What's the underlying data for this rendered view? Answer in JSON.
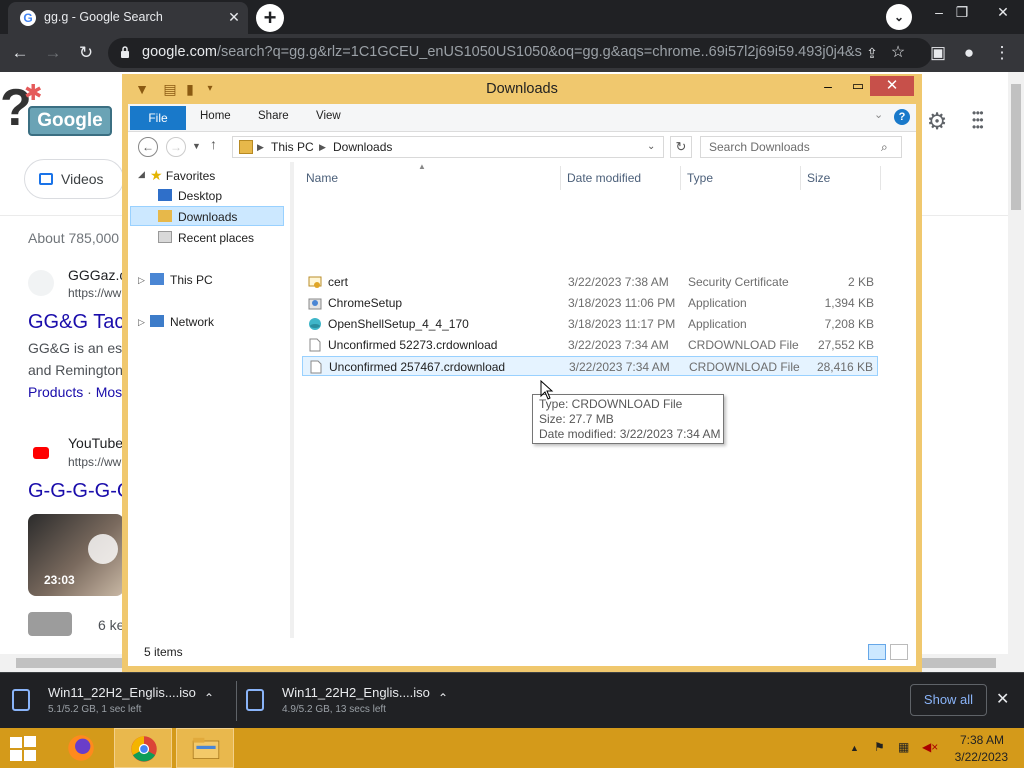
{
  "browser": {
    "tab_title": "gg.g - Google Search",
    "tab_favicon": "G",
    "url_host": "google.com",
    "url_rest": "/search?q=gg.g&rlz=1C1GCEU_enUS1050US1050&oq=gg.g&aqs=chrome..69i57l2j69i59.493j0j4&so..."
  },
  "google": {
    "logo_text": "Google",
    "videos_label": "Videos",
    "result_stats": "About 785,000",
    "results": [
      {
        "site": "GGGaz.c",
        "cite": "https://ww",
        "title": "GG&G Tact",
        "snippet1": "GG&G is an est",
        "snippet2": "and Remington",
        "link1": "Products",
        "sep": " · ",
        "link2": "Mos"
      },
      {
        "site": "YouTube",
        "cite": "https://ww",
        "title": "G-G-G-G-G"
      }
    ],
    "video_duration": "23:03",
    "key_moments": "6 ke"
  },
  "explorer": {
    "title": "Downloads",
    "ribbon_tabs": [
      "File",
      "Home",
      "Share",
      "View"
    ],
    "breadcrumb": [
      "This PC",
      "Downloads"
    ],
    "search_placeholder": "Search Downloads",
    "nav": {
      "favorites": "Favorites",
      "desktop": "Desktop",
      "downloads": "Downloads",
      "recent": "Recent places",
      "this_pc": "This PC",
      "network": "Network"
    },
    "columns": [
      "Name",
      "Date modified",
      "Type",
      "Size"
    ],
    "files": [
      {
        "name": "cert",
        "date": "3/22/2023 7:38 AM",
        "type": "Security Certificate",
        "size": "2 KB",
        "icon": "certificate-icon"
      },
      {
        "name": "ChromeSetup",
        "date": "3/18/2023 11:06 PM",
        "type": "Application",
        "size": "1,394 KB",
        "icon": "installer-icon"
      },
      {
        "name": "OpenShellSetup_4_4_170",
        "date": "3/18/2023 11:17 PM",
        "type": "Application",
        "size": "7,208 KB",
        "icon": "shell-icon"
      },
      {
        "name": "Unconfirmed 52273.crdownload",
        "date": "3/22/2023 7:34 AM",
        "type": "CRDOWNLOAD File",
        "size": "27,552 KB",
        "icon": "file-icon"
      },
      {
        "name": "Unconfirmed 257467.crdownload",
        "date": "3/22/2023 7:34 AM",
        "type": "CRDOWNLOAD File",
        "size": "28,416 KB",
        "icon": "file-icon"
      }
    ],
    "tooltip": {
      "type": "Type: CRDOWNLOAD File",
      "size": "Size: 27.7 MB",
      "date": "Date modified: 3/22/2023 7:34 AM"
    },
    "status": "5 items"
  },
  "downloads_bar": {
    "items": [
      {
        "name": "Win11_22H2_Englis....iso",
        "status": "5.1/5.2 GB, 1 sec left"
      },
      {
        "name": "Win11_22H2_Englis....iso",
        "status": "4.9/5.2 GB, 13 secs left"
      }
    ],
    "show_all": "Show all"
  },
  "taskbar": {
    "time": "7:38 AM",
    "date": "3/22/2023"
  }
}
